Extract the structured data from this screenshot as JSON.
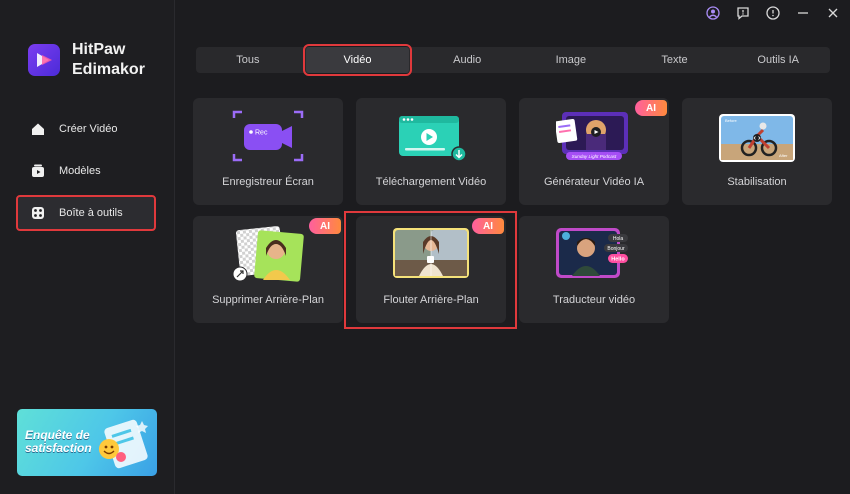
{
  "brand": {
    "line1": "HitPaw",
    "line2": "Edimakor"
  },
  "sidebar": {
    "items": [
      {
        "label": "Créer Vidéo",
        "icon": "home-icon"
      },
      {
        "label": "Modèles",
        "icon": "template-icon"
      },
      {
        "label": "Boîte à outils",
        "icon": "toolbox-icon",
        "active": true
      }
    ],
    "promo": {
      "line1": "Enquête de",
      "line2": "satisfaction"
    }
  },
  "window_controls": [
    "user-icon",
    "feedback-icon",
    "info-icon",
    "minimize-icon",
    "close-icon"
  ],
  "tabs": [
    {
      "label": "Tous"
    },
    {
      "label": "Vidéo",
      "active": true
    },
    {
      "label": "Audio"
    },
    {
      "label": "Image"
    },
    {
      "label": "Texte"
    },
    {
      "label": "Outils IA"
    }
  ],
  "tools": [
    {
      "label": "Enregistreur Écran",
      "badge": "",
      "thumb_text": "Rec"
    },
    {
      "label": "Téléchargement Vidéo",
      "badge": ""
    },
    {
      "label": "Générateur Vidéo IA",
      "badge": "AI",
      "thumb_text": "Sunday Light Podcast"
    },
    {
      "label": "Stabilisation",
      "badge": "",
      "thumb_text_before": "Before",
      "thumb_text_after": "After"
    },
    {
      "label": "Supprimer Arrière-Plan",
      "badge": "AI"
    },
    {
      "label": "Flouter Arrière-Plan",
      "badge": "AI"
    },
    {
      "label": "Traducteur vidéo",
      "badge": "",
      "thumb_words": [
        "Hola",
        "Bonjour",
        "Hello"
      ]
    }
  ],
  "colors": {
    "highlight": "#e0393c",
    "accent": "#7b3df0",
    "ai_badge_start": "#ff5f9e",
    "ai_badge_end": "#ff8a3d"
  }
}
